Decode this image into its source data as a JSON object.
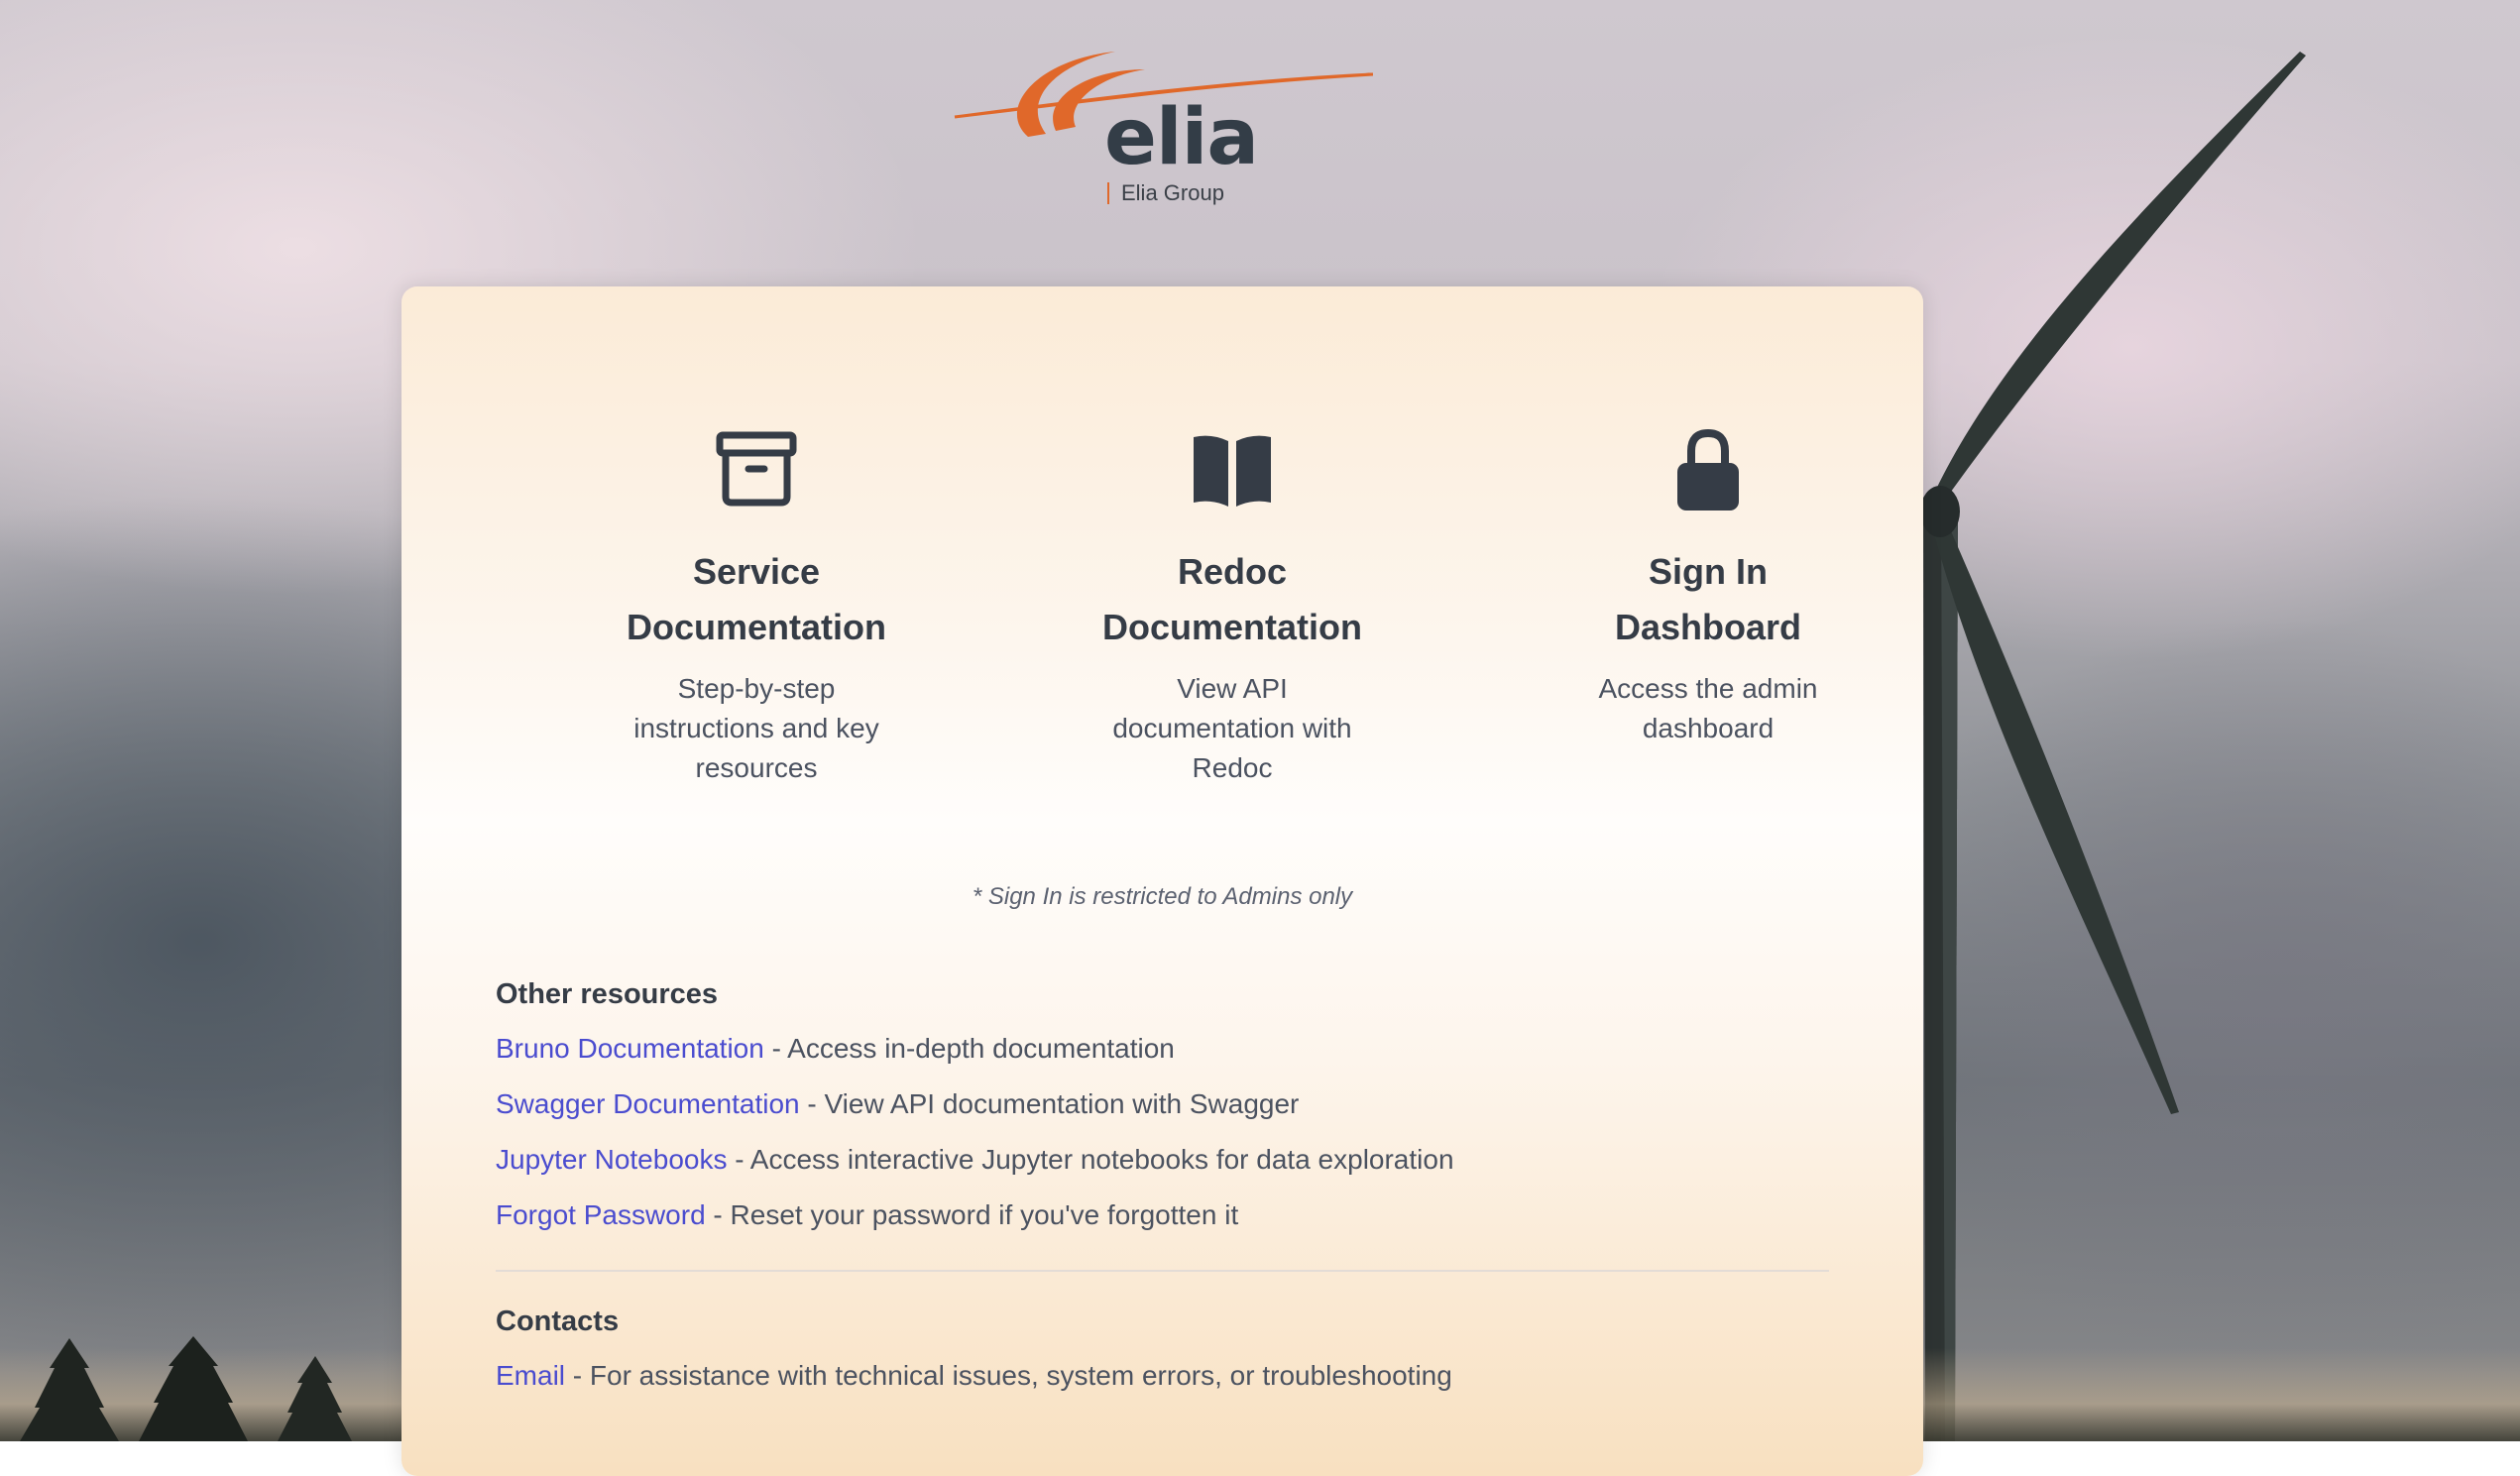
{
  "brand": {
    "name": "elia",
    "subtitle": "Elia Group",
    "accent_color": "#e0682a"
  },
  "tiles": [
    {
      "icon": "archive-box-icon",
      "title_line1": "Service",
      "title_line2": "Documentation",
      "desc_line1": "Step-by-step",
      "desc_line2": "instructions and key",
      "desc_line3": "resources"
    },
    {
      "icon": "book-open-icon",
      "title_line1": "Redoc",
      "title_line2": "Documentation",
      "desc_line1": "View API",
      "desc_line2": "documentation with",
      "desc_line3": "Redoc"
    },
    {
      "icon": "lock-icon",
      "title_line1": "Sign In",
      "title_line2": "Dashboard",
      "desc_line1": "Access the admin",
      "desc_line2": "dashboard",
      "desc_line3": ""
    }
  ],
  "note": "* Sign In is restricted to Admins only",
  "other_resources": {
    "title": "Other resources",
    "items": [
      {
        "link": "Bruno Documentation",
        "desc": " - Access in-depth documentation"
      },
      {
        "link": "Swagger Documentation",
        "desc": " - View API documentation with Swagger"
      },
      {
        "link": "Jupyter Notebooks",
        "desc": " - Access interactive Jupyter notebooks for data exploration"
      },
      {
        "link": "Forgot Password",
        "desc": " - Reset your password if you've forgotten it"
      }
    ]
  },
  "contacts": {
    "title": "Contacts",
    "items": [
      {
        "link": "Email",
        "desc": " - For assistance with technical issues, system errors, or troubleshooting"
      }
    ]
  },
  "colors": {
    "link": "#4a4ccf",
    "heading": "#353c46",
    "text": "#4b5260"
  }
}
